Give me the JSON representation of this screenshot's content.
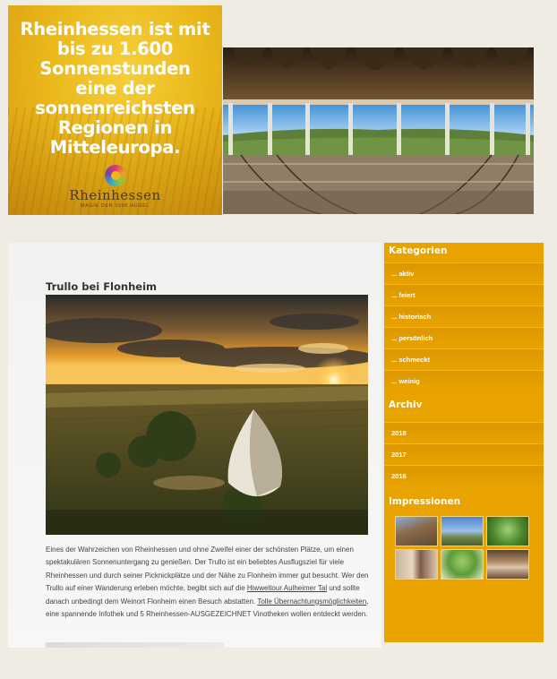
{
  "promo": {
    "headline": "Rheinhessen ist mit\nbis zu 1.600\nSonnenstunden\neine der\nsonnenreichsten\nRegionen in\nMitteleuropa.",
    "brand": "Rheinhessen",
    "tagline": "MAGIE DER 1000 HÜGEL"
  },
  "article": {
    "title": "Trullo bei Flonheim",
    "body_part1": "Eines der Wahrzeichen von Rheinhessen und ohne Zweifel einer der schönsten Plätze, um einen spektakulären Sonnenuntergang zu genießen. Der Trullo ist ein beliebtes Ausflugsziel für viele Rheinhessen und durch seiner Picknickplätze und der Nähe zu Flonheim immer gut besucht. Wer den Trullo auf einer Wanderung erleben möchte, begibt sich auf die ",
    "link1": "Hiwweltour Aulheimer Tal",
    "body_part2": " und sollte danach unbedingt dem Weinort Flonheim einen Besuch abstatten. ",
    "link2": "Tolle Übernachtungsmöglichkeiten",
    "body_part3": ", eine spannende Infothek und 5 Rheinhessen-AUSGEZEICHNET Vinotheken wollen entdeckt werden."
  },
  "sidebar": {
    "categories_heading": "Kategorien",
    "categories": [
      "... aktiv",
      "... feiert",
      "... historisch",
      "... persönlich",
      "... schmeckt",
      "... weinig"
    ],
    "archive_heading": "Archiv",
    "archive": [
      "2018",
      "2017",
      "2016"
    ],
    "impressions_heading": "Impressionen"
  },
  "colors": {
    "sidebar": "#e8a300",
    "promo": "#eab91c",
    "page_bg": "#efece4"
  }
}
